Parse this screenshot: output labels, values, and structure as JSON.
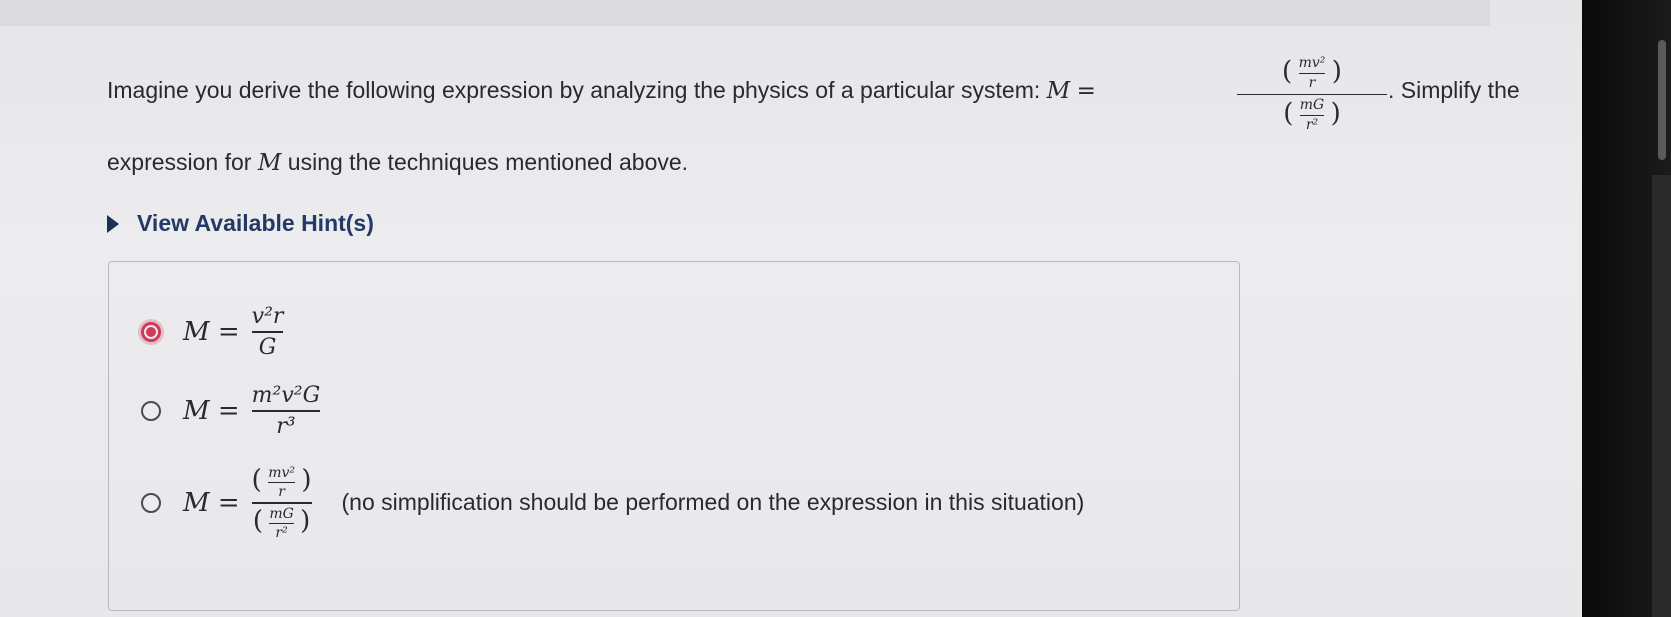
{
  "question": {
    "text_before": "Imagine you derive the following expression by analyzing the physics of a particular system: ",
    "symbol": "M",
    "equals": "=",
    "numerator": "mv²",
    "numerator_den": "r",
    "denominator": "mG",
    "denominator_den": "r²",
    "text_after": ". Simplify the",
    "line2_before": "expression for ",
    "line2_symbol": "M",
    "line2_after": " using the techniques mentioned above."
  },
  "hints": {
    "label": "View Available Hint(s)"
  },
  "options": [
    {
      "lhs": "M =",
      "num": "v²r",
      "den": "G",
      "selected": true
    },
    {
      "lhs": "M =",
      "num": "m²v²G",
      "den": "r³",
      "selected": false
    },
    {
      "lhs": "M =",
      "num_inner": "mv²",
      "num_inner_den": "r",
      "den_inner": "mG",
      "den_inner_den": "r²",
      "note": "(no simplification should be performed on the expression in this situation)",
      "selected": false
    }
  ],
  "colors": {
    "accent": "#d23a5a",
    "hint_text": "#243a66",
    "text": "#2a2a2e"
  }
}
